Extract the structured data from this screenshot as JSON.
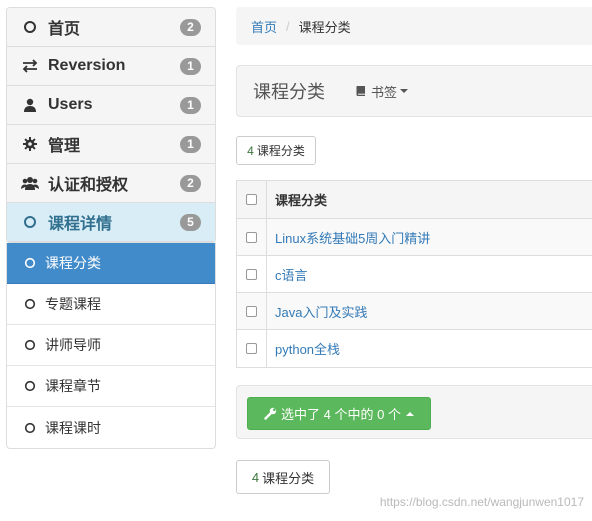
{
  "sidebar": {
    "items": [
      {
        "label": "首页",
        "badge": "2",
        "icon": "circle-icon"
      },
      {
        "label": "Reversion",
        "badge": "1",
        "icon": "exchange-icon"
      },
      {
        "label": "Users",
        "badge": "1",
        "icon": "user-icon"
      },
      {
        "label": "管理",
        "badge": "1",
        "icon": "gear-icon"
      },
      {
        "label": "认证和授权",
        "badge": "2",
        "icon": "users-icon"
      },
      {
        "label": "课程详情",
        "badge": "5",
        "icon": "circle-icon"
      }
    ],
    "subitems": [
      {
        "label": "课程分类",
        "active": true
      },
      {
        "label": "专题课程"
      },
      {
        "label": "讲师导师"
      },
      {
        "label": "课程章节"
      },
      {
        "label": "课程课时"
      }
    ]
  },
  "breadcrumb": {
    "home": "首页",
    "separator": "/",
    "current": "课程分类"
  },
  "page_header": {
    "title": "课程分类",
    "bookmark_label": "书签"
  },
  "count_top": {
    "number": "4",
    "label": "课程分类"
  },
  "table": {
    "header": "课程分类",
    "rows": [
      "Linux系统基础5周入门精讲",
      "c语言",
      "Java入门及实践",
      "python全栈"
    ]
  },
  "action": {
    "label": "选中了 4 个中的 0 个"
  },
  "count_bottom": {
    "number": "4",
    "label": "课程分类"
  },
  "watermark": "https://blog.csdn.net/wangjunwen1017",
  "colors": {
    "primary": "#428bca",
    "success": "#5cb85c",
    "link": "#337ab7",
    "active_parent_bg": "#d9edf7"
  }
}
